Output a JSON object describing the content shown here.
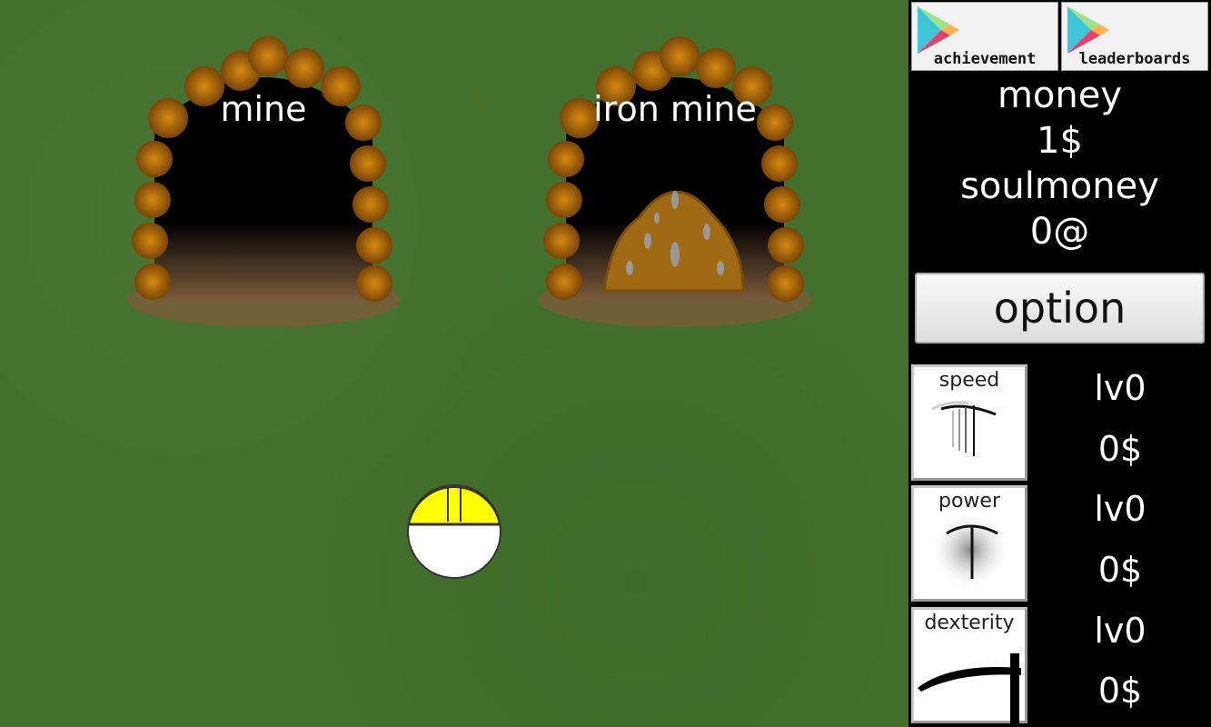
{
  "field": {
    "mines": [
      {
        "label": "mine",
        "has_ore": false
      },
      {
        "label": "iron mine",
        "has_ore": true
      }
    ]
  },
  "sidebar": {
    "achievement_label": "achievement",
    "leaderboards_label": "leaderboards",
    "money_label": "money",
    "money_value": "1$",
    "soulmoney_label": "soulmoney",
    "soulmoney_value": "0@",
    "option_label": "option",
    "upgrades": [
      {
        "name": "speed",
        "level": "lv0",
        "cost": "0$",
        "icon": "pickaxe-speed-icon"
      },
      {
        "name": "power",
        "level": "lv0",
        "cost": "0$",
        "icon": "pickaxe-power-icon"
      },
      {
        "name": "dexterity",
        "level": "lv0",
        "cost": "0$",
        "icon": "scythe-icon"
      }
    ]
  },
  "colors": {
    "grass": "#43702c",
    "rock": "#a8660c",
    "helmet": "#ffff00"
  }
}
